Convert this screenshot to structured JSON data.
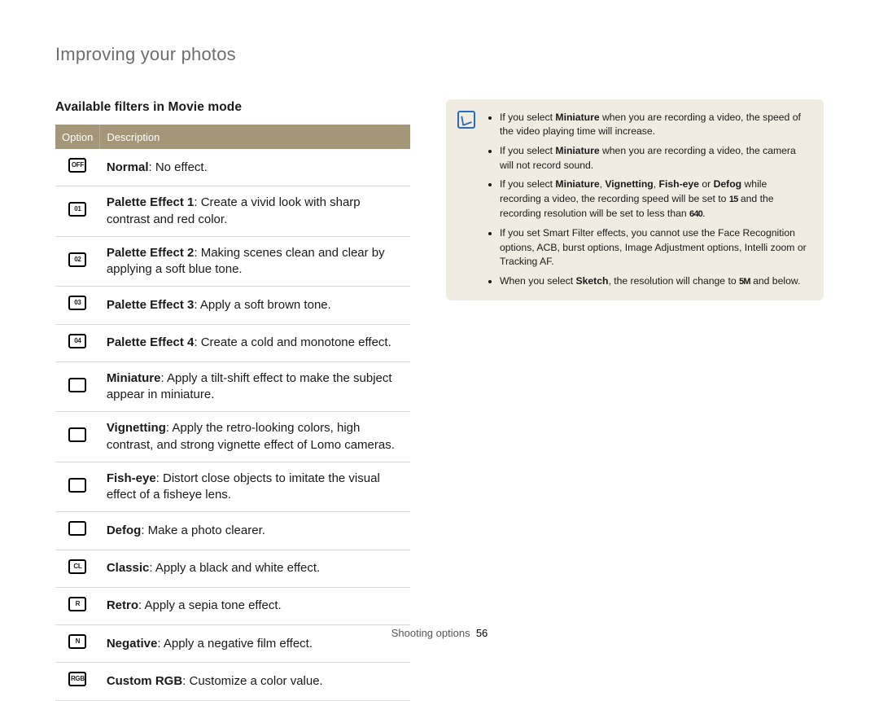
{
  "page_title": "Improving your photos",
  "section_title": "Available filters in Movie mode",
  "table": {
    "head_option": "Option",
    "head_description": "Description",
    "rows": [
      {
        "icon_label": "OFF",
        "name": "Normal",
        "desc": ": No effect."
      },
      {
        "icon_label": "01",
        "name": "Palette Effect 1",
        "desc": ": Create a vivid look with sharp contrast and red color."
      },
      {
        "icon_label": "02",
        "name": "Palette Effect 2",
        "desc": ": Making scenes clean and clear by applying a soft blue tone."
      },
      {
        "icon_label": "03",
        "name": "Palette Effect 3",
        "desc": ": Apply a soft brown tone."
      },
      {
        "icon_label": "04",
        "name": "Palette Effect 4",
        "desc": ": Create a cold and monotone effect."
      },
      {
        "icon_label": "",
        "name": "Miniature",
        "desc": ": Apply a tilt-shift effect to make the subject appear in miniature."
      },
      {
        "icon_label": "",
        "name": "Vignetting",
        "desc": ": Apply the retro-looking colors, high contrast, and strong vignette effect of Lomo cameras."
      },
      {
        "icon_label": "",
        "name": "Fish-eye",
        "desc": ": Distort close objects to imitate the visual effect of a fisheye lens."
      },
      {
        "icon_label": "",
        "name": "Defog",
        "desc": ": Make a photo clearer."
      },
      {
        "icon_label": "CL",
        "name": "Classic",
        "desc": ": Apply a black and white effect."
      },
      {
        "icon_label": "R",
        "name": "Retro",
        "desc": ": Apply a sepia tone effect."
      },
      {
        "icon_label": "N",
        "name": "Negative",
        "desc": ": Apply a negative film effect."
      },
      {
        "icon_label": "RGB",
        "name": "Custom RGB",
        "desc": ": Customize a color value."
      }
    ]
  },
  "notes": {
    "items": [
      {
        "pre": "If you select ",
        "bold1": "Miniature",
        "post": " when you are recording a video, the speed of the video playing time will increase."
      },
      {
        "pre": "If you select ",
        "bold1": "Miniature",
        "post": " when you are recording a video, the camera will not record sound."
      },
      {
        "pre": "If you select ",
        "bold1": "Miniature",
        "mid1": ", ",
        "bold2": "Vignetting",
        "mid2": ", ",
        "bold3": "Fish-eye",
        "mid3": " or ",
        "bold4": "Defog",
        "post1": " while recording a video, the recording speed will be set to ",
        "sym1": "15",
        "post2": " and the recording resolution will be set to less than ",
        "sym2": "640",
        "post3": "."
      },
      {
        "pre": "If you set Smart Filter effects, you cannot use the Face Recognition options, ACB, burst options, Image Adjustment options, Intelli zoom or Tracking AF."
      },
      {
        "pre": "When you select ",
        "bold1": "Sketch",
        "post1": ", the resolution will change to ",
        "sym1": "5M",
        "post2": " and below."
      }
    ]
  },
  "footer": {
    "section": "Shooting options",
    "page": "56"
  }
}
